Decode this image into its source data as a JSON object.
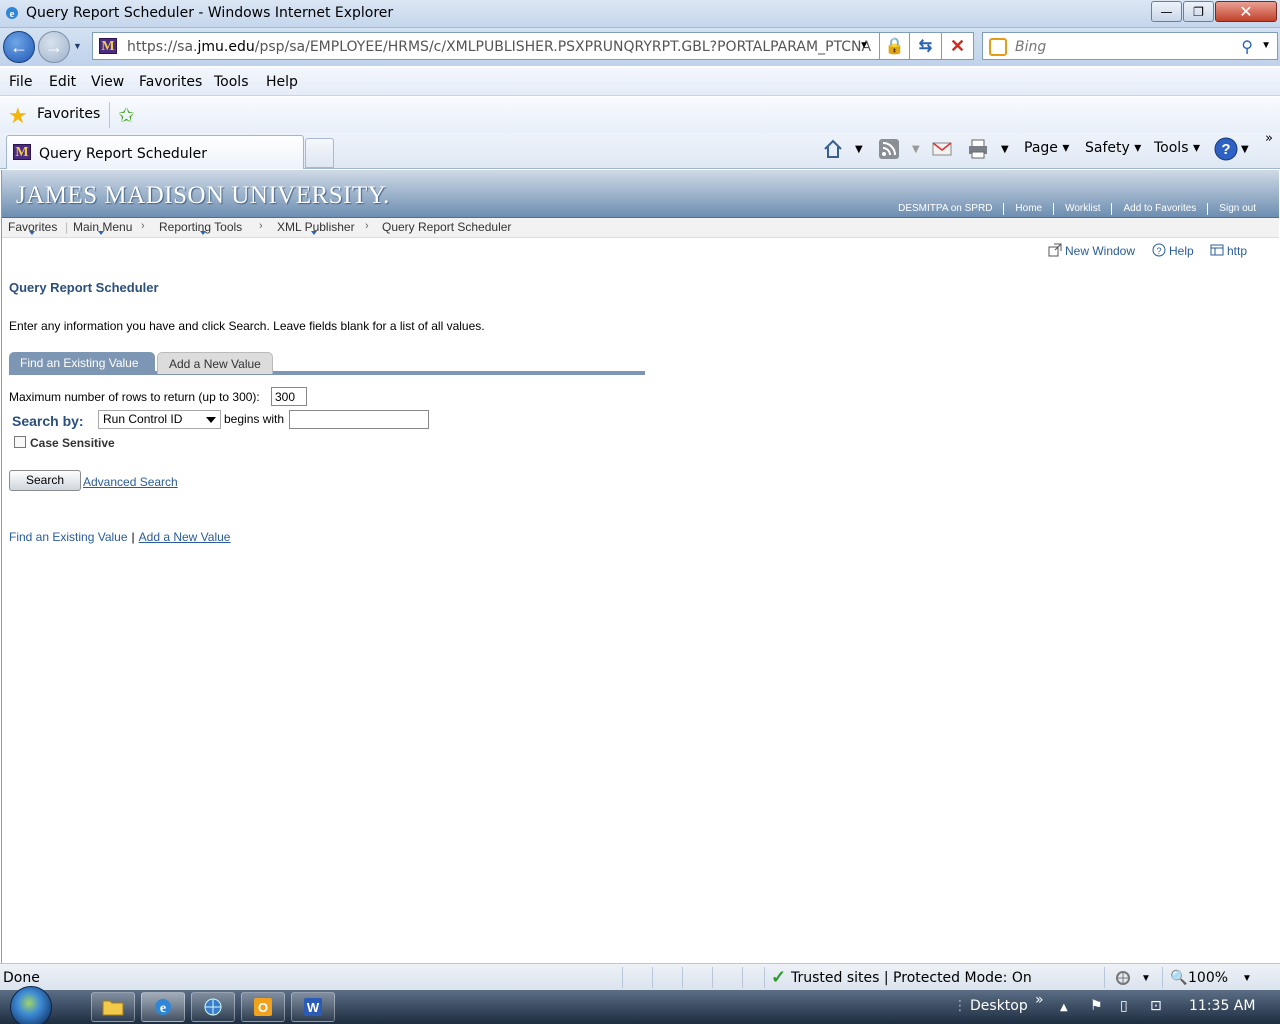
{
  "window": {
    "title": "Query Report Scheduler - Windows Internet Explorer",
    "minimize": "—",
    "restore": "❐",
    "close": "✕"
  },
  "address": {
    "url_prefix": "https://sa.",
    "url_domain": "jmu.edu",
    "url_path": "/psp/sa/EMPLOYEE/HRMS/c/XMLPUBLISHER.PSXPRUNQRYRPT.GBL?PORTALPARAM_PTCNA",
    "search_placeholder": "Bing"
  },
  "menu": [
    "File",
    "Edit",
    "View",
    "Favorites",
    "Tools",
    "Help"
  ],
  "favbar": {
    "label": "Favorites"
  },
  "tab": {
    "title": "Query Report Scheduler"
  },
  "commandbar": {
    "page": "Page",
    "safety": "Safety",
    "tools": "Tools"
  },
  "banner": {
    "logo": "JAMES MADISON UNIVERSITY.",
    "links": [
      "DESMITPA on SPRD",
      "Home",
      "Worklist",
      "Add to Favorites",
      "Sign out"
    ]
  },
  "breadcrumbs": [
    "Favorites",
    "Main Menu",
    "Reporting Tools",
    "XML Publisher",
    "Query Report Scheduler"
  ],
  "toplinks": {
    "new_window": "New Window",
    "help": "Help",
    "http": "http"
  },
  "page": {
    "title": "Query Report Scheduler",
    "instructions": "Enter any information you have and click Search. Leave fields blank for a list of all values.",
    "tabs": [
      "Find an Existing Value",
      "Add a New Value"
    ],
    "max_rows_label": "Maximum number of rows to return (up to 300):",
    "max_rows_value": "300",
    "search_by_label": "Search by:",
    "search_by_value": "Run Control ID",
    "begins_with": "begins with",
    "case_sensitive": "Case Sensitive",
    "search_button": "Search",
    "advanced_search": "Advanced Search",
    "bottom_links": [
      "Find an Existing Value",
      "Add a New Value"
    ]
  },
  "status": {
    "text": "Done",
    "zone": "Trusted sites | Protected Mode: On",
    "zoom": "100%"
  },
  "taskbar": {
    "desktop": "Desktop",
    "time": "11:35 AM",
    "apps": [
      "folder",
      "ie",
      "network",
      "outlook",
      "word"
    ]
  }
}
